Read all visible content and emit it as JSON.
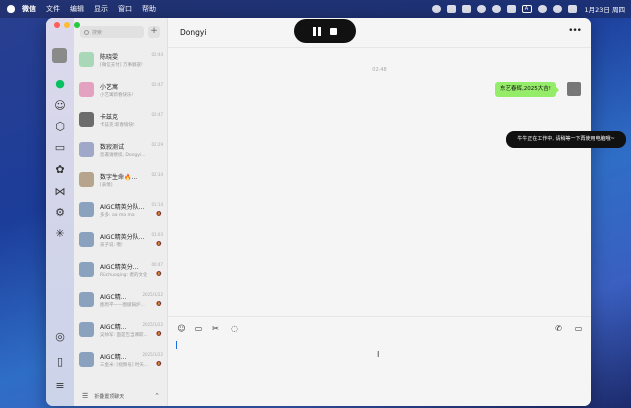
{
  "menubar": {
    "app_name": "微信",
    "items": [
      "文件",
      "编辑",
      "显示",
      "窗口",
      "帮助"
    ],
    "input_indicator": "A",
    "date": "1月23日 周四"
  },
  "window": {
    "search": {
      "placeholder": "搜索"
    },
    "add_label": "+",
    "sessions": [
      {
        "name": "陈晓雯",
        "time": "02:44",
        "preview": "[微信支付] 万事顺遂!"
      },
      {
        "name": "小艺寓",
        "time": "02:47",
        "preview": "小艺寓新春快乐!"
      },
      {
        "name": "卡兹克",
        "time": "02:47",
        "preview": "卡兹克:新春愉快!"
      },
      {
        "name": "数寂测试",
        "time": "02:29",
        "preview": "您邀请继续, Dongyi..."
      },
      {
        "name": "数字生命🔥...",
        "time": "02:34",
        "preview": "[表情]"
      },
      {
        "name": "AIGC精英分队...",
        "time": "01:14",
        "preview": "多多: aa ma ma",
        "muted": true
      },
      {
        "name": "AIGC精英分队...",
        "time": "01:03",
        "preview": "孩子说: 哦!",
        "muted": true
      },
      {
        "name": "AIGC精英分...",
        "time": "00:47",
        "preview": "Rüchuoqing: 者的文化",
        "muted": true
      },
      {
        "name": "AIGC精...",
        "time": "2025/1/22",
        "preview": "图周平——图级锅炉...",
        "muted": true
      },
      {
        "name": "AIGC精...",
        "time": "2025/1/22",
        "preview": "吴帅军: 面是告当课职...",
        "muted": true
      },
      {
        "name": "AIGC精...",
        "time": "2025/1/22",
        "preview": "三金米: [视频号] 时天...",
        "muted": true
      }
    ],
    "muted_icon": "🔕",
    "folded_label": "折叠置顶聊天",
    "chat": {
      "title": "Dongyi",
      "timestamp": "02:48",
      "messages": [
        {
          "text": "东艺春辉,2025大吉!",
          "from_me": true
        }
      ]
    }
  },
  "recording_toast": "牛牛正在工作中, 请稍等一下再使用电脑哦~",
  "colors": {
    "accent_green": "#95ec69",
    "session_bg": "#eeeeee",
    "chat_bg": "#f5f5f5"
  }
}
